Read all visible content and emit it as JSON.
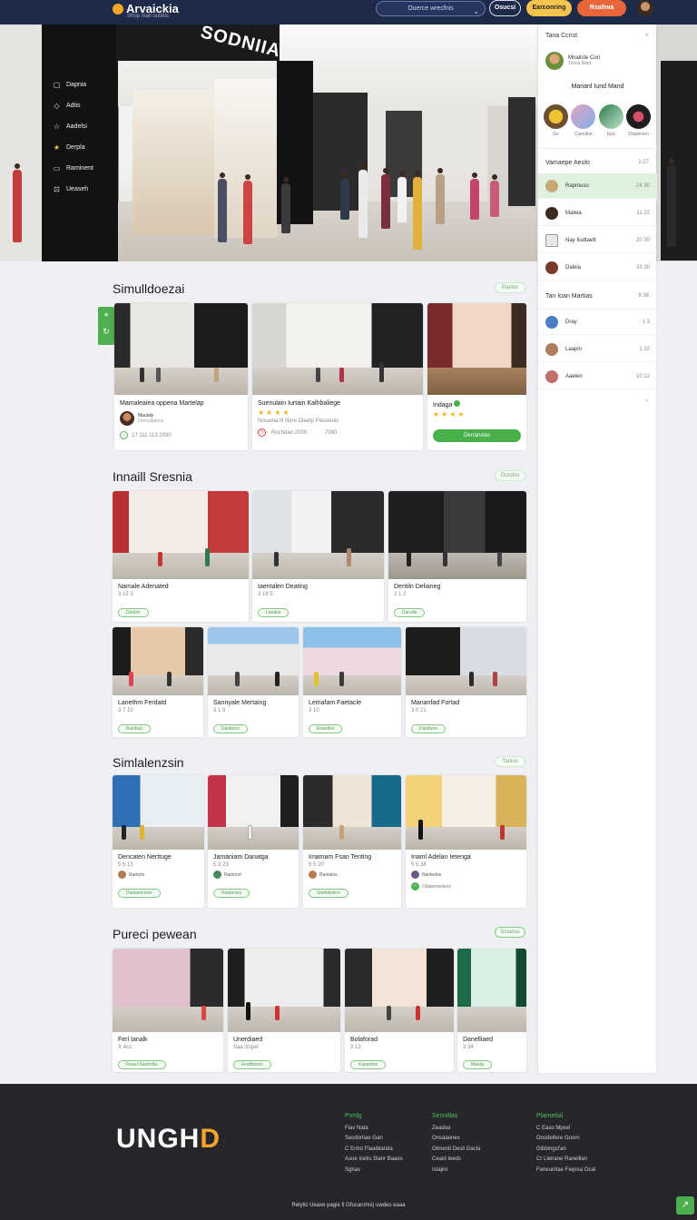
{
  "header": {
    "logo": "Arvaickia",
    "logo_sub": "Shop mall outlets",
    "search_placeholder": "Ouerce wrecfnis",
    "btn_outline": "Osucsi",
    "btn_yellow": "Earconring",
    "btn_orange": "Rsaltwa"
  },
  "hero": {
    "sign": "SODNIIA",
    "menu": [
      {
        "label": "Dapnia",
        "icon": "square-icon"
      },
      {
        "label": "Adtis",
        "icon": "diamond-icon"
      },
      {
        "label": "Aadelsi",
        "icon": "star-icon"
      },
      {
        "label": "Derpla",
        "icon": "star-icon"
      },
      {
        "label": "Raminent",
        "icon": "screen-icon"
      },
      {
        "label": "Ueaseh",
        "icon": "bag-icon"
      }
    ]
  },
  "panel": {
    "title": "Tana Ccnst",
    "user_name": "Mnaliste Cori",
    "user_sub": "Tosna Nept",
    "subtitle": "Marianl Iund Mand",
    "tiles": [
      "Ge",
      "Ciaeulbe",
      "Epd",
      "Depeinien"
    ],
    "sec1_title": "Vamaepe Aeulo",
    "sec1_val": "2.27",
    "list1": [
      {
        "label": "Rapmusu",
        "val": "24 30",
        "active": true
      },
      {
        "label": "Maleia",
        "val": "11 22",
        "active": false
      },
      {
        "label": "Nay Iiudtaett",
        "val": "20 30",
        "active": false
      },
      {
        "label": "Daleia",
        "val": "33 30",
        "active": false
      }
    ],
    "sec2_title": "Tan Ioan Martias",
    "sec2_val": "8 38",
    "list2": [
      {
        "label": "Dray",
        "val": "1 3"
      },
      {
        "label": "Laapin",
        "val": "1 32"
      },
      {
        "label": "Aaelen",
        "val": "10 12"
      }
    ]
  },
  "sections": [
    {
      "title": "Simulldoezai",
      "btn": "Paslos"
    },
    {
      "title": "Innaill Sresnia",
      "btn": "Oosdos"
    },
    {
      "title": "Simlalenzsin",
      "btn": "Tanios"
    },
    {
      "title": "Pureci pewean",
      "btn": "Sinadas"
    }
  ],
  "row1": [
    {
      "title": "Mamaleaiea oppena Martelap",
      "user": "Mauialy",
      "user_sub": "Dernalbance",
      "meta": "17 111 113 2030"
    },
    {
      "title": "Suenulain Iurtain Kalhbaliege",
      "meta": "Nosama til Nirre Dlaetp Pessieuis",
      "meta2": "Rochdan 2030",
      "meta3": "7080"
    },
    {
      "title": "Indaga",
      "btn": "Derranslas"
    }
  ],
  "row2": [
    {
      "title": "Namale Adenated",
      "meta": "3 15 3",
      "chip": "Desblo"
    },
    {
      "title": "Iaentalen Deating",
      "meta": "3 19 5",
      "chip": "Leedos"
    },
    {
      "title": "Dentiln Delianeg",
      "meta": "2 1 2",
      "chip": "Dacolis"
    }
  ],
  "row3": [
    {
      "title": "Lanethm Ferdatd",
      "meta": "3 7 10",
      "chip": "Baiobas"
    },
    {
      "title": "Sannyale Mertaing",
      "meta": "3 1 9",
      "chip": "Dasbons"
    },
    {
      "title": "Lemafam Faetacle",
      "meta": "3 10",
      "chip": "Roastlos"
    },
    {
      "title": "Mananfad Fortad",
      "meta": "3 0 21",
      "chip": "Daisborn"
    }
  ],
  "row4": [
    {
      "title": "Dencaten Nerttuge",
      "meta": "5 5 13",
      "user": "Rantolo",
      "chip": "Danlaninnios"
    },
    {
      "title": "Jamaniam Danatga",
      "meta": "5 3 23",
      "user": "Raniorol",
      "chip": "Riodanios"
    },
    {
      "title": "Imamam Fsan Tenting",
      "meta": "5 5 20",
      "user": "Rantalos",
      "chip": "Sdeletistins"
    },
    {
      "title": "Inaml Adelan Ietenga",
      "meta": "5 5 38",
      "user": "Nanledos",
      "chip": "Oiqiaemsdenz"
    }
  ],
  "row5": [
    {
      "title": "Ferl Ianalk",
      "meta": "X 4ss",
      "chip": "Rasel Sastortlis"
    },
    {
      "title": "Unerdiaed",
      "meta": "Saa Sopel",
      "chip": "Fesdtooen"
    },
    {
      "title": "Bolaforad",
      "meta": "3 12",
      "chip": "Kasantos"
    },
    {
      "title": "Danelliaed",
      "meta": "3 34",
      "chip": "Mastis"
    }
  ],
  "footer": {
    "logo_a": "UNGH",
    "logo_b": "D",
    "cols": [
      {
        "head": "Pordg",
        "items": [
          "Fiav Nata",
          "Sasdortiae Gan",
          "C Erdst Flaaiblanda",
          "Asoe Icetis Slanr Baaos",
          "Sghas"
        ]
      },
      {
        "head": "Sesnitlas",
        "items": [
          "Zeadoa",
          "Onsaaones",
          "Otmentl Desli Gacla",
          "Ceaid Ieeds",
          "Istajini"
        ]
      },
      {
        "head": "Plarnetial",
        "items": [
          "C Easo Mpxel",
          "Oosdelfere Goorn",
          "Gibbingsl'an",
          "Cr Lleirane Ranelilan",
          "Faneuiritae Fiepisa Ocal"
        ]
      }
    ],
    "copyright": "Relytic Ueaxe pagie fi Gfucarohni) uwdes eaaa",
    "fab": "↗"
  },
  "colors": {
    "accent": "#47b04a",
    "nav": "#1d2a4a",
    "yellow": "#f6c44d",
    "orange": "#e8663a"
  }
}
